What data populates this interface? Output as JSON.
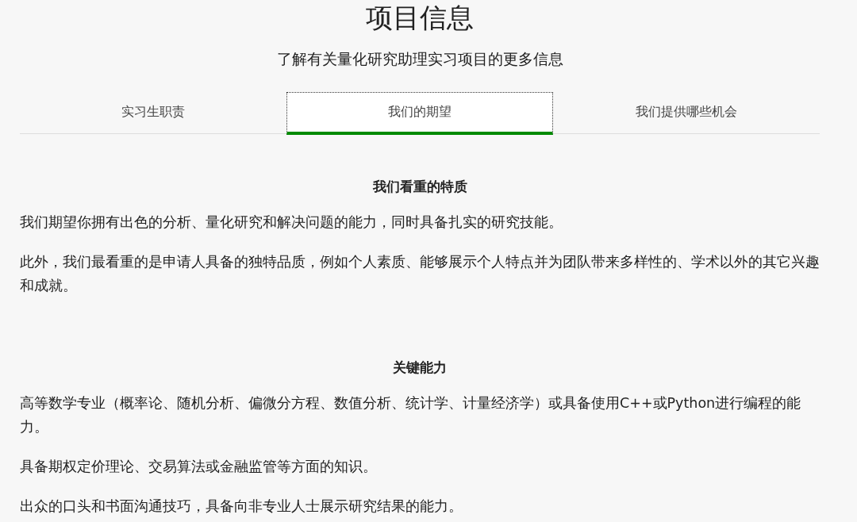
{
  "title": "项目信息",
  "subtitle": "了解有关量化研究助理实习项目的更多信息",
  "tabs": [
    {
      "label": "实习生职责",
      "selected": false
    },
    {
      "label": "我们的期望",
      "selected": true
    },
    {
      "label": "我们提供哪些机会",
      "selected": false
    }
  ],
  "sections": [
    {
      "heading": "我们看重的特质",
      "paragraphs": [
        "我们期望你拥有出色的分析、量化研究和解决问题的能力，同时具备扎实的研究技能。",
        "此外，我们最看重的是申请人具备的独特品质，例如个人素质、能够展示个人特点并为团队带来多样性的、学术以外的其它兴趣和成就。"
      ]
    },
    {
      "heading": "关键能力",
      "paragraphs": [
        "高等数学专业（概率论、随机分析、偏微分方程、数值分析、统计学、计量经济学）或具备使用C++或Python进行编程的能力。",
        "具备期权定价理论、交易算法或金融监管等方面的知识。",
        "出众的口头和书面沟通技巧，具备向非专业人士展示研究结果的能力。"
      ]
    }
  ]
}
